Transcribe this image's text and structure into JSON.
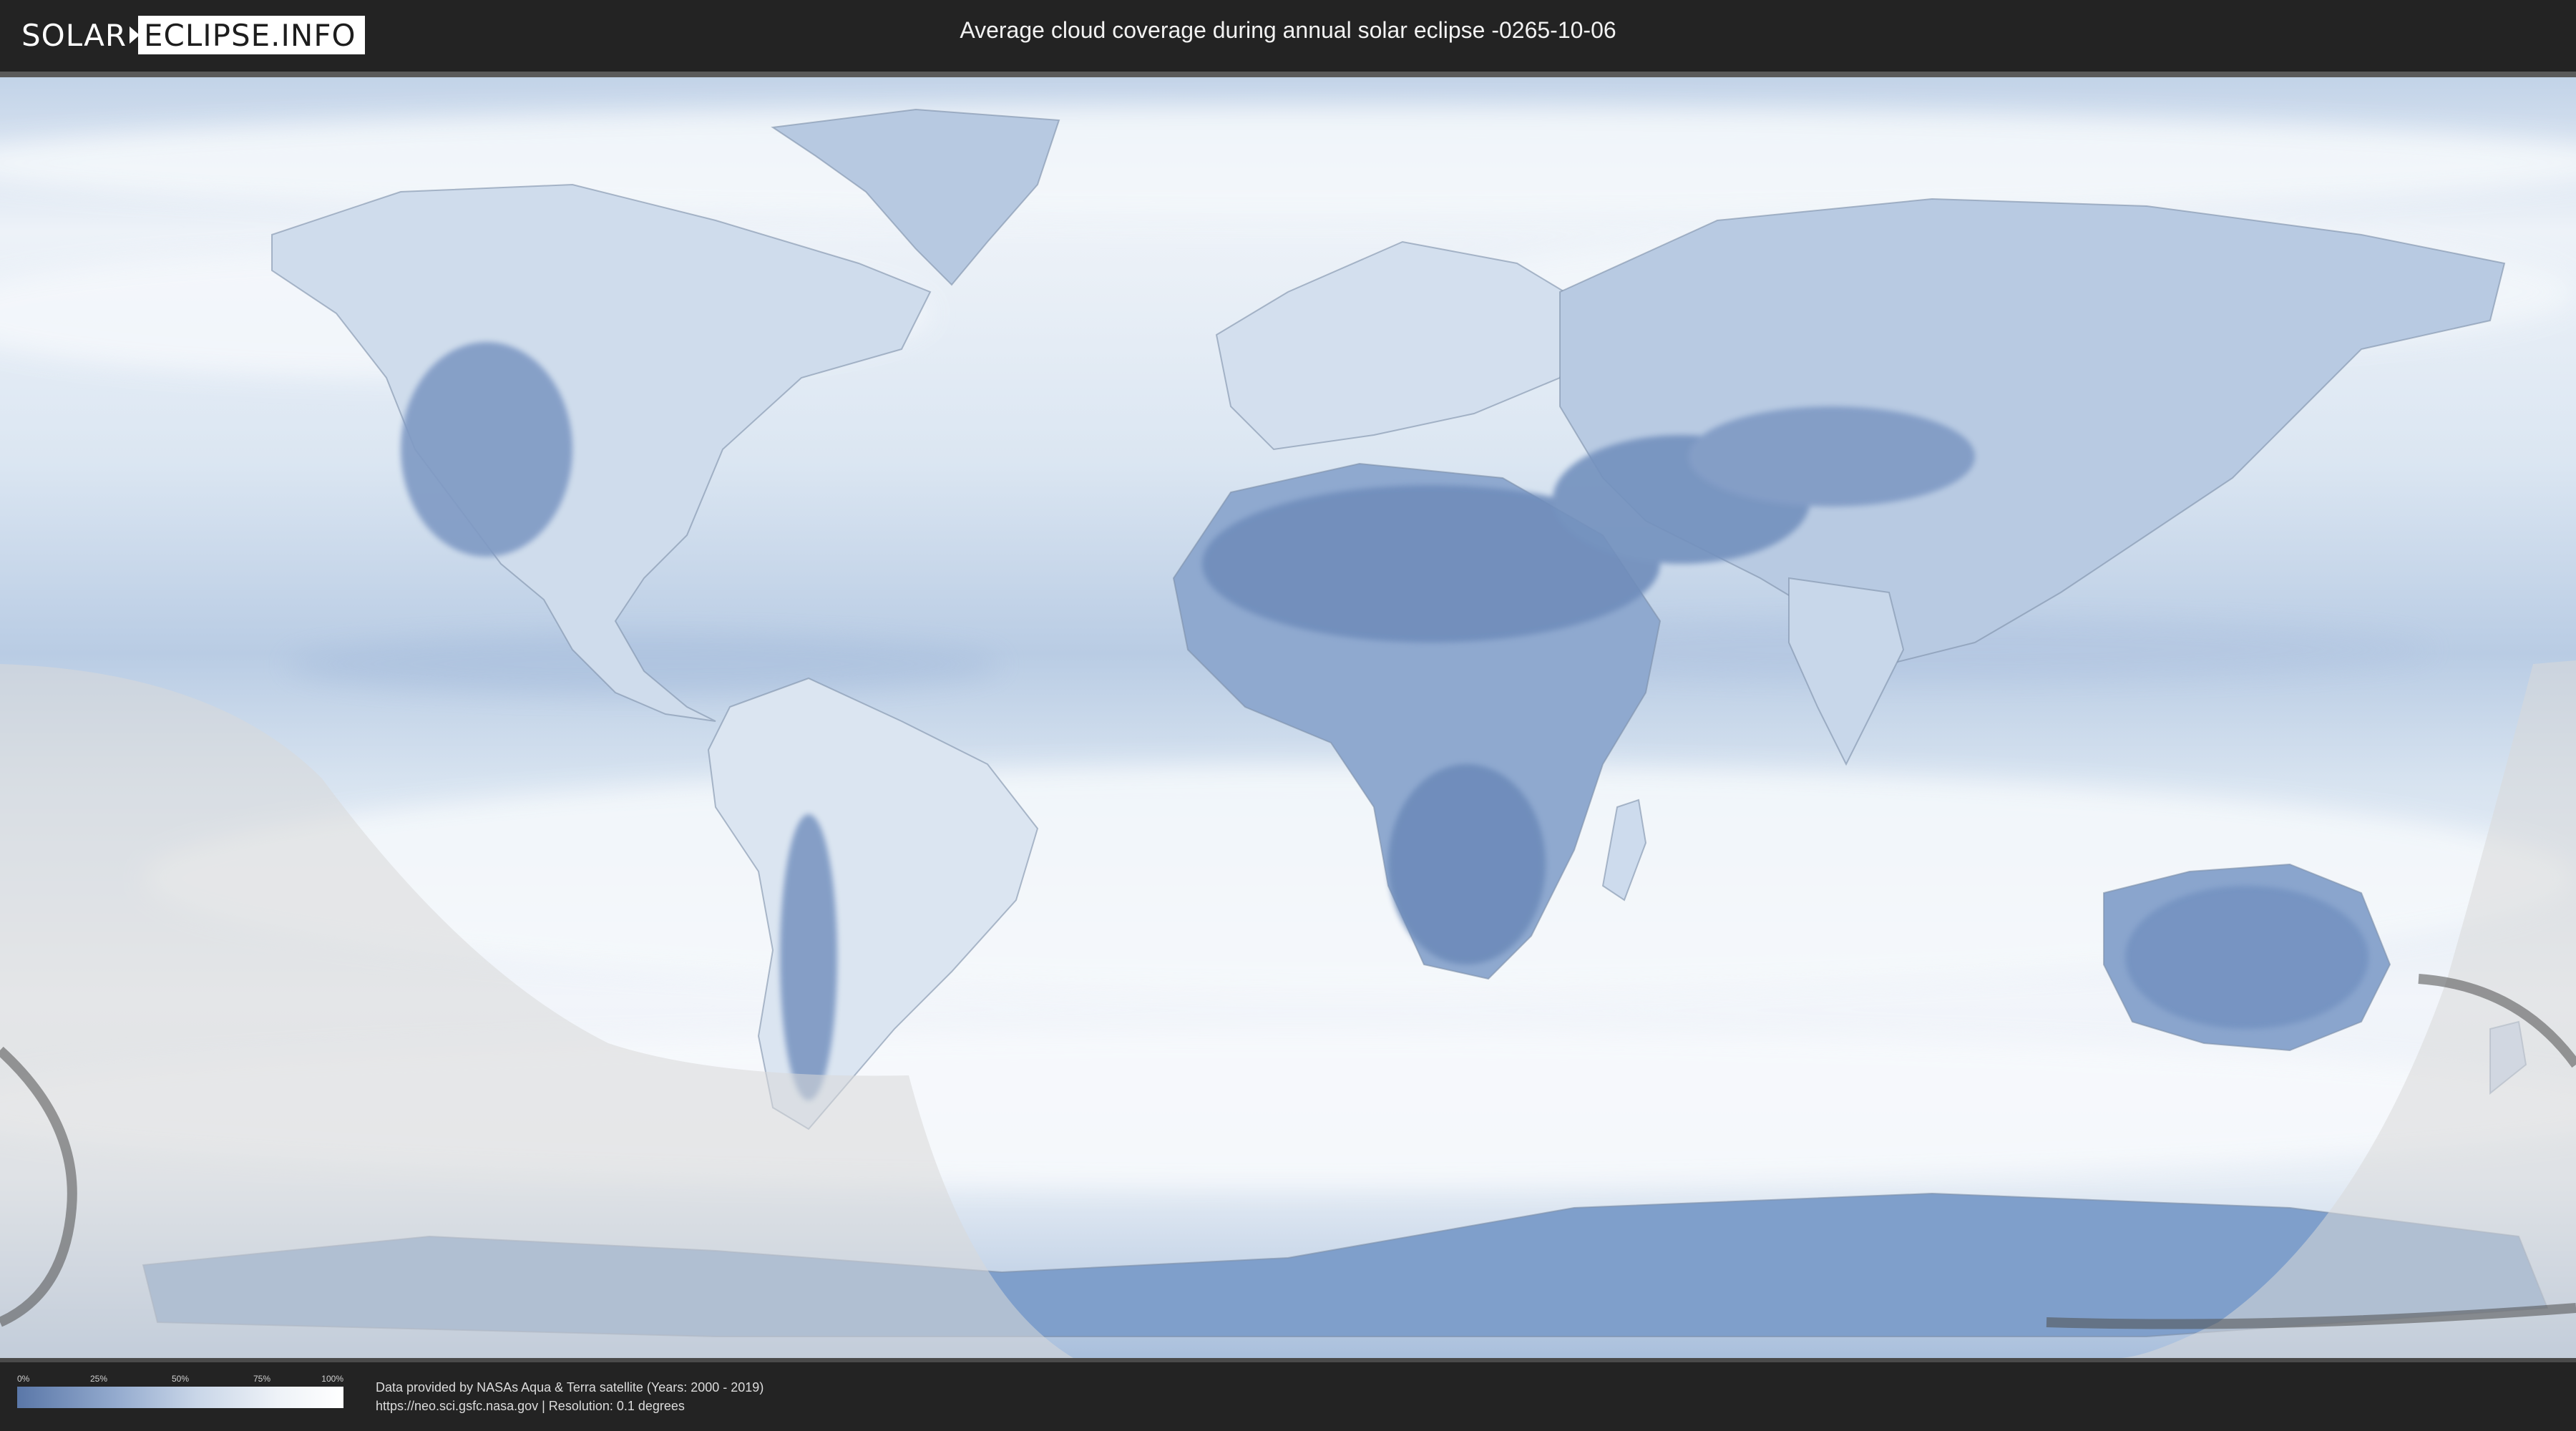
{
  "header": {
    "logo_left": "SOLAR",
    "logo_right": "ECLIPSE.INFO",
    "title": "Average cloud coverage during annual solar eclipse -0265-10-06"
  },
  "legend": {
    "ticks": [
      "0%",
      "25%",
      "50%",
      "75%",
      "100%"
    ],
    "colors": [
      "#5a77a8",
      "#93aace",
      "#c9d6e8",
      "#eef2f7",
      "#ffffff"
    ]
  },
  "footer": {
    "credit_line1": "Data provided by NASAs Aqua & Terra satellite (Years: 2000 - 2019)",
    "credit_line2": "https://neo.sci.gsfc.nasa.gov | Resolution: 0.1 degrees"
  },
  "map": {
    "projection": "equirectangular",
    "overlay_color": "#dcdcdc",
    "path_color": "#555555",
    "land_dark_color": "#5f7eb0",
    "cloud_color": "#f4f7fb"
  }
}
